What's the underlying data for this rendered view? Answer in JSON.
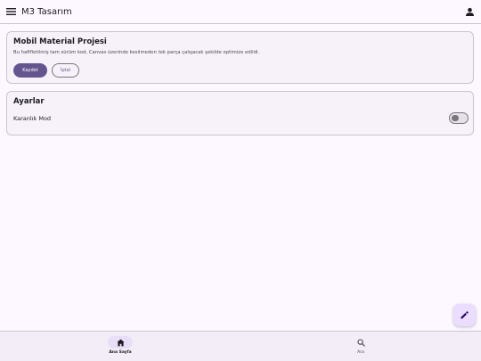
{
  "app_bar": {
    "title": "M3 Tasarım",
    "menu_icon": "menu-icon",
    "account_icon": "account-icon"
  },
  "project_card": {
    "title": "Mobil Material Projesi",
    "description": "Bu hafifletilmiş tam sürüm kod, Canvas üzerinde kesilmeden tek parça çalışacak şekilde optimize edildi.",
    "primary_button": "Kaydet",
    "secondary_button": "İptal"
  },
  "settings_card": {
    "title": "Ayarlar",
    "dark_mode_label": "Karanlık Mod",
    "dark_mode_enabled": false
  },
  "fab": {
    "icon": "edit-icon"
  },
  "bottom_nav": {
    "items": [
      {
        "label": "Ana Sayfa",
        "icon": "home-icon",
        "active": true
      },
      {
        "label": "Ara",
        "icon": "search-icon",
        "active": false
      }
    ]
  },
  "colors": {
    "primary": "#65558f",
    "background": "#fdf7ff",
    "surface_container": "#f7f2fa",
    "outline": "#79747e",
    "outline_variant": "#cac4d0",
    "fab_container": "#eaddff",
    "nav_indicator": "#e8def8"
  }
}
